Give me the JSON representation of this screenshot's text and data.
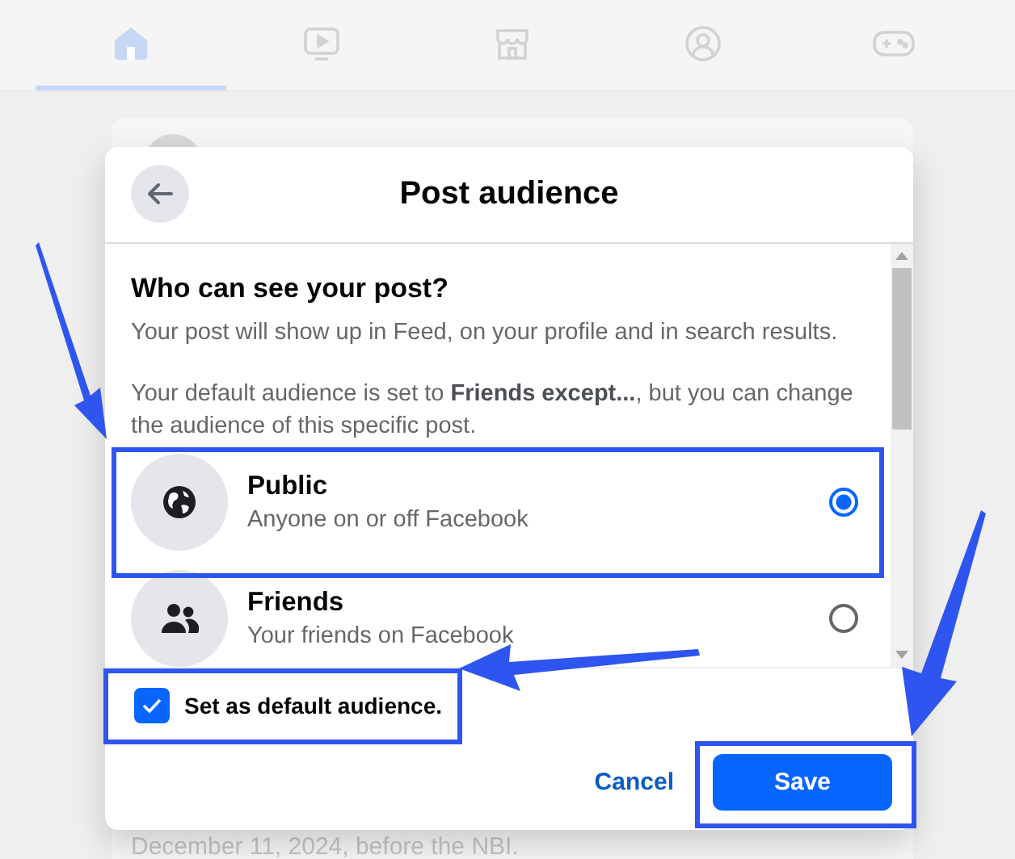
{
  "nav_tabs": [
    {
      "kind": "home",
      "selected": true
    },
    {
      "kind": "video",
      "selected": false
    },
    {
      "kind": "marketplace",
      "selected": false
    },
    {
      "kind": "profile",
      "selected": false
    },
    {
      "kind": "gaming",
      "selected": false
    }
  ],
  "background_post": {
    "text": "December 11, 2024, before the NBI."
  },
  "dialog": {
    "title": "Post audience",
    "heading": "Who can see your post?",
    "description": "Your post will show up in Feed, on your profile and in search results.",
    "default_notice": "Your default audience is set to **Friends except...**, but you can change the audience of this specific post.",
    "options": [
      {
        "kind": "globe",
        "name": "Public",
        "description": "Anyone on or off Facebook",
        "selected": true
      },
      {
        "kind": "people",
        "name": "Friends",
        "description": "Your friends on Facebook",
        "selected": false
      }
    ],
    "default_checkbox": {
      "label": "Set as default audience.",
      "checked": true
    },
    "cancel": "Cancel",
    "save": "Save"
  }
}
